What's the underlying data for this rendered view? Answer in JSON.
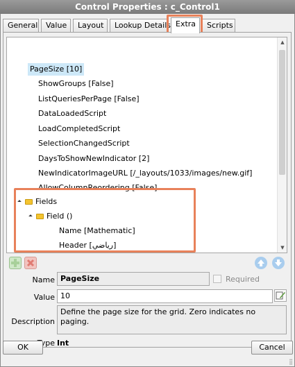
{
  "window": {
    "title": "Control Properties : c_Control1"
  },
  "tabs": [
    {
      "label": "General"
    },
    {
      "label": "Value"
    },
    {
      "label": "Layout"
    },
    {
      "label": "Lookup Details"
    },
    {
      "label": "Extra"
    },
    {
      "label": "Scripts"
    }
  ],
  "active_tab": "Extra",
  "tree": {
    "items": [
      {
        "label": "PageSize [10]"
      },
      {
        "label": "ShowGroups [False]"
      },
      {
        "label": "ListQueriesPerPage [False]"
      },
      {
        "label": "DataLoadedScript"
      },
      {
        "label": "LoadCompletedScript"
      },
      {
        "label": "SelectionChangedScript"
      },
      {
        "label": "DaysToShowNewIndicator [2]"
      },
      {
        "label": "NewIndicatorImageURL [/_layouts/1033/images/new.gif]"
      },
      {
        "label": "AllowColumnReordering [False]"
      },
      {
        "label": "Fields"
      },
      {
        "label": "Field ()"
      },
      {
        "label": "Name [Mathematic]"
      },
      {
        "label": "Header [رياضي]"
      }
    ]
  },
  "accent": {
    "highlight": "#e8815a",
    "selected_bg": "#cde8f8"
  },
  "icons": {
    "add": "plus-icon",
    "delete": "x-icon",
    "move_up": "arrow-up-icon",
    "move_down": "arrow-down-icon",
    "edit": "edit-pencil-icon"
  },
  "properties": {
    "name_label": "Name",
    "name_value": "PageSize",
    "required_label": "Required",
    "value_label": "Value",
    "value_value": "10",
    "description_label": "Description",
    "description_value": "Define the page size for the grid. Zero indicates no paging.",
    "type_label": "Type",
    "type_value": "Int"
  },
  "buttons": {
    "ok": "OK",
    "cancel": "Cancel"
  }
}
